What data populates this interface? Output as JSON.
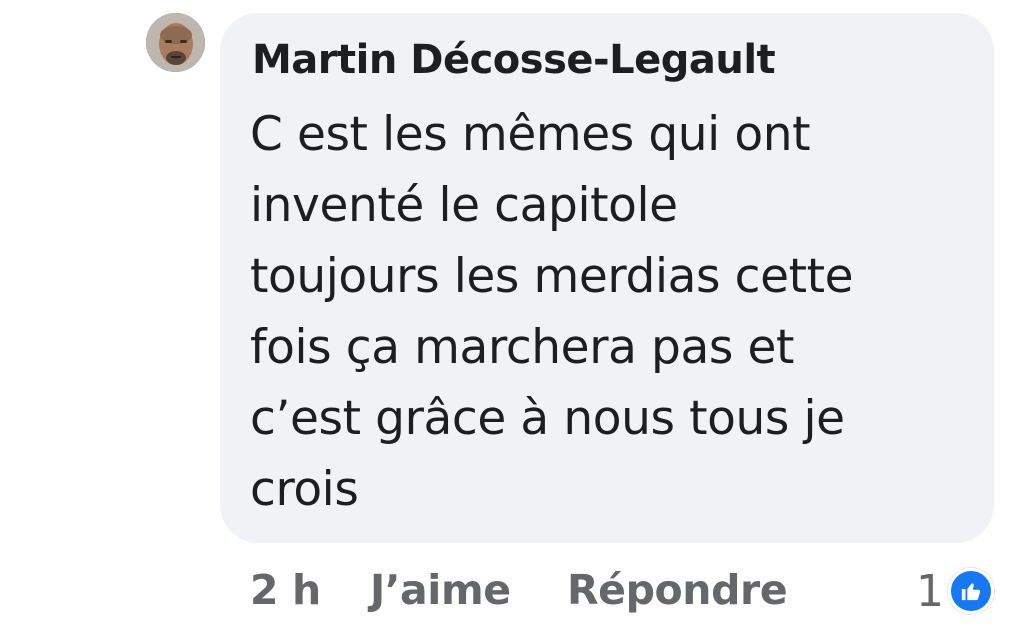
{
  "comment": {
    "author": "Martin Décosse-Legault",
    "text_lines": [
      "C est les mêmes qui ont",
      "inventé le capitole",
      "toujours les merdias cette",
      "fois ça marchera pas et",
      "c’est grâce à nous tous je",
      "crois"
    ],
    "timestamp": "2 h",
    "like_label": "J’aime",
    "reply_label": "Répondre",
    "reaction_count": "1",
    "reaction_icon": "thumbs-up-icon"
  },
  "colors": {
    "bubble_background": "#f0f2f5",
    "text": "#1c1e21",
    "secondary_text": "#65676b",
    "like_blue": "#1877f2"
  }
}
